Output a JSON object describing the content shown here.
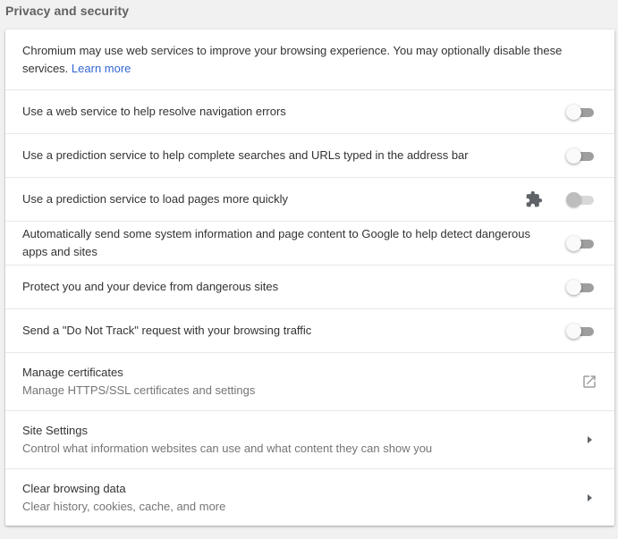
{
  "section": {
    "title": "Privacy and security"
  },
  "intro": {
    "text": "Chromium may use web services to improve your browsing experience. You may optionally disable these services.",
    "link": "Learn more"
  },
  "toggles": [
    {
      "label": "Use a web service to help resolve navigation errors",
      "enabled": false,
      "policy_controlled": false
    },
    {
      "label": "Use a prediction service to help complete searches and URLs typed in the address bar",
      "enabled": false,
      "policy_controlled": false
    },
    {
      "label": "Use a prediction service to load pages more quickly",
      "enabled": false,
      "policy_controlled": true
    },
    {
      "label": "Automatically send some system information and page content to Google to help detect dangerous apps and sites",
      "enabled": false,
      "policy_controlled": false
    },
    {
      "label": "Protect you and your device from dangerous sites",
      "enabled": false,
      "policy_controlled": false
    },
    {
      "label": "Send a \"Do Not Track\" request with your browsing traffic",
      "enabled": false,
      "policy_controlled": false
    }
  ],
  "nav": [
    {
      "title": "Manage certificates",
      "subtitle": "Manage HTTPS/SSL certificates and settings",
      "icon": "open-in-new-icon"
    },
    {
      "title": "Site Settings",
      "subtitle": "Control what information websites can use and what content they can show you",
      "icon": "chevron-right-icon"
    },
    {
      "title": "Clear browsing data",
      "subtitle": "Clear history, cookies, cache, and more",
      "icon": "chevron-right-icon"
    }
  ],
  "colors": {
    "link": "#3367d6",
    "toggle_off_track": "#9e9e9e",
    "icon": "#5f6368"
  }
}
